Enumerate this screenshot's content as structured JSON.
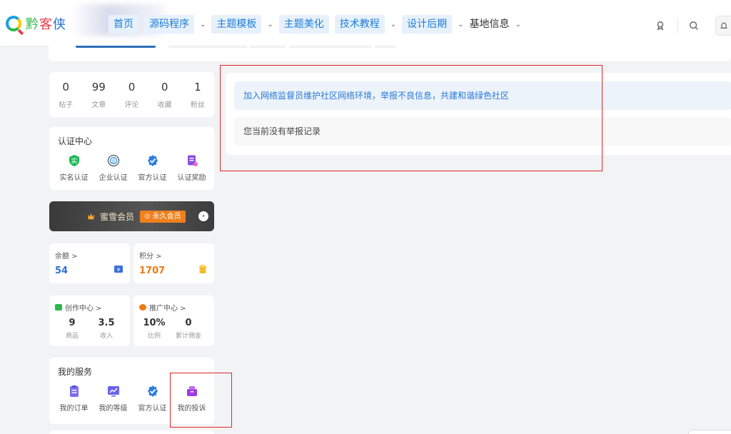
{
  "brand": {
    "name_part1": "黔",
    "name_part2": "客",
    "name_part3": "侠"
  },
  "nav": {
    "items": [
      {
        "label": "首页",
        "has_menu": false
      },
      {
        "label": "源码程序",
        "has_menu": true
      },
      {
        "label": "主题模板",
        "has_menu": true
      },
      {
        "label": "主题美化",
        "has_menu": false
      },
      {
        "label": "技术教程",
        "has_menu": true
      },
      {
        "label": "设计后期",
        "has_menu": true
      },
      {
        "label": "基地信息",
        "has_menu": true
      }
    ],
    "icons": [
      "badge-icon",
      "search-icon",
      "bell-icon"
    ]
  },
  "stats": [
    {
      "value": "0",
      "label": "帖子"
    },
    {
      "value": "99",
      "label": "文章"
    },
    {
      "value": "0",
      "label": "评论"
    },
    {
      "value": "0",
      "label": "收藏"
    },
    {
      "value": "1",
      "label": "粉丝"
    }
  ],
  "auth_center": {
    "title": "认证中心",
    "items": [
      {
        "label": "实名认证",
        "icon": "real-name-icon",
        "color": "#19b955"
      },
      {
        "label": "企业认证",
        "icon": "enterprise-icon",
        "color": "#1f8bd6"
      },
      {
        "label": "官方认证",
        "icon": "official-verified-icon",
        "color": "#2d7ee6"
      },
      {
        "label": "认证奖励",
        "icon": "reward-icon",
        "color": "#8a4fe0"
      }
    ]
  },
  "vip": {
    "name": "蜜雪会员",
    "badge": "⊙ 永久会员"
  },
  "balance": {
    "label": "余额 >",
    "value": "54",
    "color": "#2d6fd8"
  },
  "points": {
    "label": "积分 >",
    "value": "1707",
    "color": "#f07a12"
  },
  "creation": {
    "title": "创作中心 >",
    "items": [
      {
        "value": "9",
        "label": "商品"
      },
      {
        "value": "3.5",
        "label": "收入"
      }
    ]
  },
  "promotion": {
    "title": "推广中心 >",
    "items": [
      {
        "value": "10%",
        "label": "比例"
      },
      {
        "value": "0",
        "label": "累计佣金"
      }
    ]
  },
  "services": {
    "title": "我的服务",
    "items": [
      {
        "label": "我的订单",
        "icon": "orders-icon",
        "color": "#7b6ef0"
      },
      {
        "label": "我的等级",
        "icon": "level-chart-icon",
        "color": "#6b63e6"
      },
      {
        "label": "官方认证",
        "icon": "official-verified-icon",
        "color": "#2d7ee6"
      },
      {
        "label": "我的投诉",
        "icon": "complaint-icon",
        "color": "#a03ce0"
      }
    ]
  },
  "report_panel": {
    "notice": "加入网络监督员维护社区网络环境，举报不良信息，共建和谐绿色社区",
    "empty_text": "您当前没有举报记录"
  },
  "colors": {
    "accent": "#1d7cd8",
    "annotation_red": "#e0262b"
  }
}
